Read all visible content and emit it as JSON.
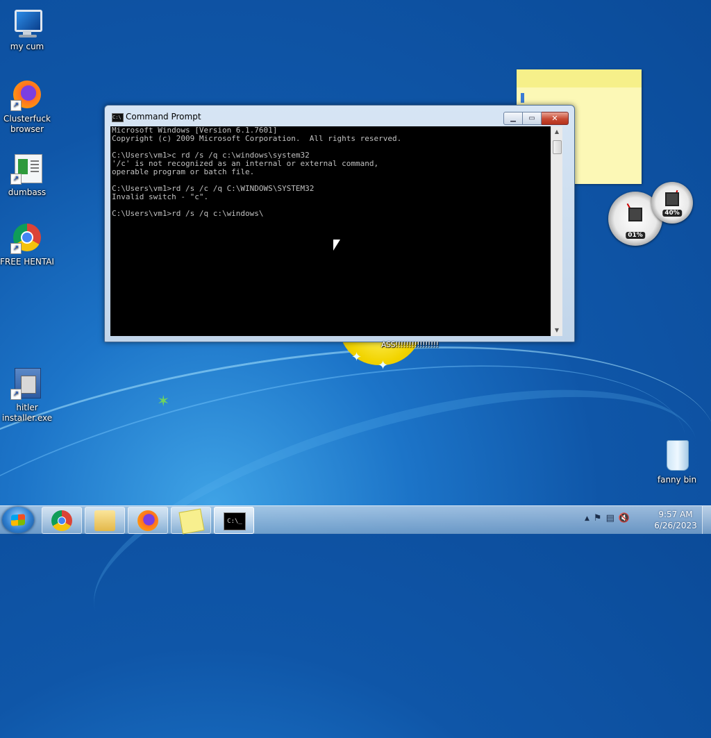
{
  "desktop": {
    "icons": [
      {
        "label": "my cum",
        "icon": "computer-icon"
      },
      {
        "label": "Clusterfuck browser",
        "icon": "firefox-icon"
      },
      {
        "label": "dumbass",
        "icon": "document-icon"
      },
      {
        "label": "FREE HENTAI",
        "icon": "chrome-icon"
      },
      {
        "label": "hitler installer.exe",
        "icon": "installer-icon"
      },
      {
        "label": "fanny bin",
        "icon": "recycle-bin-icon"
      }
    ],
    "wallpaper_label": "ASS!!!!!!!!!!!!!!!!",
    "gadget": {
      "cpu": "01%",
      "memory": "40%"
    }
  },
  "window": {
    "title": "Command Prompt",
    "icon_text": "C:\\",
    "console_lines": [
      "Microsoft Windows [Version 6.1.7601]",
      "Copyright (c) 2009 Microsoft Corporation.  All rights reserved.",
      "",
      "C:\\Users\\vm1>c rd /s /q c:\\windows\\system32",
      "'/c' is not recognized as an internal or external command,",
      "operable program or batch file.",
      "",
      "C:\\Users\\vm1>rd /s /c /q C:\\WINDOWS\\SYSTEM32",
      "Invalid switch - \"c\".",
      "",
      "C:\\Users\\vm1>rd /s /q c:\\windows\\"
    ]
  },
  "taskbar": {
    "apps": [
      {
        "name": "Google Chrome",
        "icon": "chrome-icon"
      },
      {
        "name": "Windows Explorer",
        "icon": "folder-icon"
      },
      {
        "name": "Firefox",
        "icon": "firefox-icon"
      },
      {
        "name": "Sticky Notes",
        "icon": "sticky-notes-icon"
      },
      {
        "name": "Command Prompt",
        "icon": "cmd-icon"
      }
    ],
    "cmd_icon_text": "C:\\_",
    "tray": {
      "up_arrow": "▲",
      "flag": "⚑",
      "network": "▤",
      "volume": "🔇"
    },
    "clock": {
      "time": "9:57 AM",
      "date": "6/26/2023"
    }
  },
  "colors": {
    "console_bg": "#000000",
    "console_text": "#c0c0c0",
    "close_button": "#c74a33",
    "sticky_note": "#fcf8b6"
  }
}
